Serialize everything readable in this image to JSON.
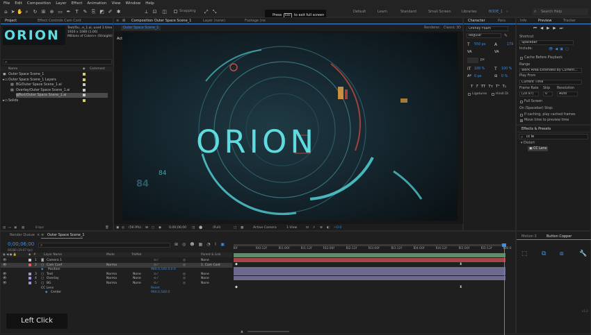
{
  "menu": [
    "File",
    "Edit",
    "Composition",
    "Layer",
    "Effect",
    "Animation",
    "View",
    "Window",
    "Help"
  ],
  "toolbar": {
    "snapping_label": "Snapping",
    "workspaces": [
      "Default",
      "Learn",
      "Standard",
      "Small Screen",
      "Libraries"
    ],
    "active_workspace": "BODE_1",
    "search_placeholder": "Search Help"
  },
  "fullscreen_hint": {
    "prefix": "Press",
    "key": "Esc",
    "suffix": "to exit full screen"
  },
  "project": {
    "tab_label": "Project",
    "effect_controls_tab": "Effect Controls Cam Cont",
    "preview_title": "ORION",
    "preview_info": [
      "Text/Ou...e_1.ai",
      "1920 x 1080 (1.00)",
      "Millions of Colors+ (Straight)"
    ],
    "used_times": "used 1 time",
    "search_placeholder": "",
    "col_name": "Name",
    "col_comment": "Comment",
    "items": [
      {
        "name": "Outer Space Scene_1",
        "indent": 0,
        "color": "#d8cf6a",
        "type": "comp"
      },
      {
        "name": "Outer Space Scene_1 Layers",
        "indent": 0,
        "color": "#d8cf6a",
        "type": "folder"
      },
      {
        "name": "BG/Outer Space Scene_1.ai",
        "indent": 1,
        "color": "#c9c9c9",
        "type": "file"
      },
      {
        "name": "Overlay/Outer Space Scene_1.ai",
        "indent": 1,
        "color": "#c9c9c9",
        "type": "file"
      },
      {
        "name": "Text/Outer Space Scene_1.ai",
        "indent": 1,
        "color": "#c9c9c9",
        "type": "file",
        "selected": true
      },
      {
        "name": "Solids",
        "indent": 0,
        "color": "#d8cf6a",
        "type": "folder"
      }
    ],
    "bpc": "8 bpc"
  },
  "composition": {
    "tab_label": "Composition Outer Space Scene_1",
    "layer_tab": "Layer (none)",
    "footage_tab": "Footage (no",
    "sub_tab": "Outer Space Scene_1",
    "renderer_label": "Renderer:",
    "renderer_value": "Classic 3D",
    "camera_label": "Active Camera",
    "title_text": "ORION",
    "hud_numbers": [
      "84",
      "84"
    ],
    "footer": {
      "zoom": "(56.9%)",
      "time": "0;00;06;00",
      "resolution": "(Full)",
      "camera": "Active Camera",
      "views": "1 View",
      "exposure": "+0.0"
    }
  },
  "character": {
    "tab_label": "Character",
    "para_tab": "Para",
    "font": "Orkney Foam",
    "style": "Regular",
    "size": "550 px",
    "leading": "179",
    "kerning": "",
    "tracking_unit": "px",
    "vscale": "100 %",
    "hscale": "100 %",
    "baseline": "0 px",
    "tsume": "0 %",
    "ligatures": "Ligatures",
    "hindi": "Hindi Di"
  },
  "preview": {
    "tabs": [
      "Info",
      "Preview",
      "Tracker"
    ],
    "shortcut_label": "Shortcut",
    "shortcut_value": "Spacebar",
    "include_label": "Include:",
    "cache_label": "Cache Before Playback",
    "range_label": "Range",
    "range_value": "Work Area Extended By Current...",
    "play_from_label": "Play From",
    "play_from_value": "Current Time",
    "frame_rate_label": "Frame Rate",
    "skip_label": "Skip",
    "resolution_label": "Resolution",
    "frame_rate_value": "(29.97)",
    "skip_value": "0",
    "resolution_value": "Auto",
    "full_screen_label": "Full Screen",
    "on_stop_label": "On (Spacebar) Stop:",
    "if_caching_label": "If caching, play cached frames",
    "move_time_label": "Move time to preview time"
  },
  "effects": {
    "tab_label": "Effects & Presets",
    "search_value": "cc le",
    "category": "Distort",
    "item": "CC Lens"
  },
  "motion": {
    "tabs": [
      "Motion 3",
      "Button Copper"
    ],
    "footer": "v1.0"
  },
  "timeline": {
    "render_queue_tab": "Render Queue",
    "comp_tab": "Outer Space Scene_1",
    "current_time": "0;00;06;00",
    "frames": "00180 (29.97 fps)",
    "columns": {
      "layer_name": "Layer Name",
      "mode": "Mode",
      "trkmat": "TrkMat",
      "parent": "Parent & Link"
    },
    "ruler": [
      "0f",
      "00:12f",
      "01:00f",
      "01:12f",
      "02:00f",
      "02:12f",
      "03:00f",
      "03:12f",
      "04:00f",
      "04:12f",
      "05:00f",
      "05:12f",
      "06:0"
    ],
    "layers": [
      {
        "num": "1",
        "name": "Camera 1",
        "mode": "",
        "trkmat": "",
        "parent": "None",
        "color": "#c7c7c7",
        "bar": "#5f8f6a"
      },
      {
        "num": "2",
        "name": "Cam Conf",
        "mode": "Norma",
        "trkmat": "",
        "parent": "1. Cam Cont",
        "color": "#e35b5b",
        "bar": "#a5444a"
      },
      {
        "num": "3",
        "name": "Text",
        "mode": "Norma",
        "trkmat": "None",
        "parent": "None",
        "color": "#9c97d8",
        "bar": "#6c6a8c"
      },
      {
        "num": "4",
        "name": "Overlay",
        "mode": "Norma",
        "trkmat": "None",
        "parent": "None",
        "color": "#9c97d8",
        "bar": "#6c6a8c"
      },
      {
        "num": "5",
        "name": "BG",
        "mode": "Norma",
        "trkmat": "None",
        "parent": "None",
        "color": "#9c97d8",
        "bar": "#6c6a8c"
      }
    ],
    "position_label": "Position",
    "position_value": "960.0,540.0,0.0",
    "cc_lens_label": "CC Lens",
    "cc_lens_reset": "Reset",
    "center_label": "Center",
    "center_value": "960.0,540.0"
  },
  "overlay_label": "Left Click",
  "colors": {
    "accent": "#3f8fe6",
    "cyan": "#5fdbe0",
    "bg": "#1d1d1d"
  }
}
